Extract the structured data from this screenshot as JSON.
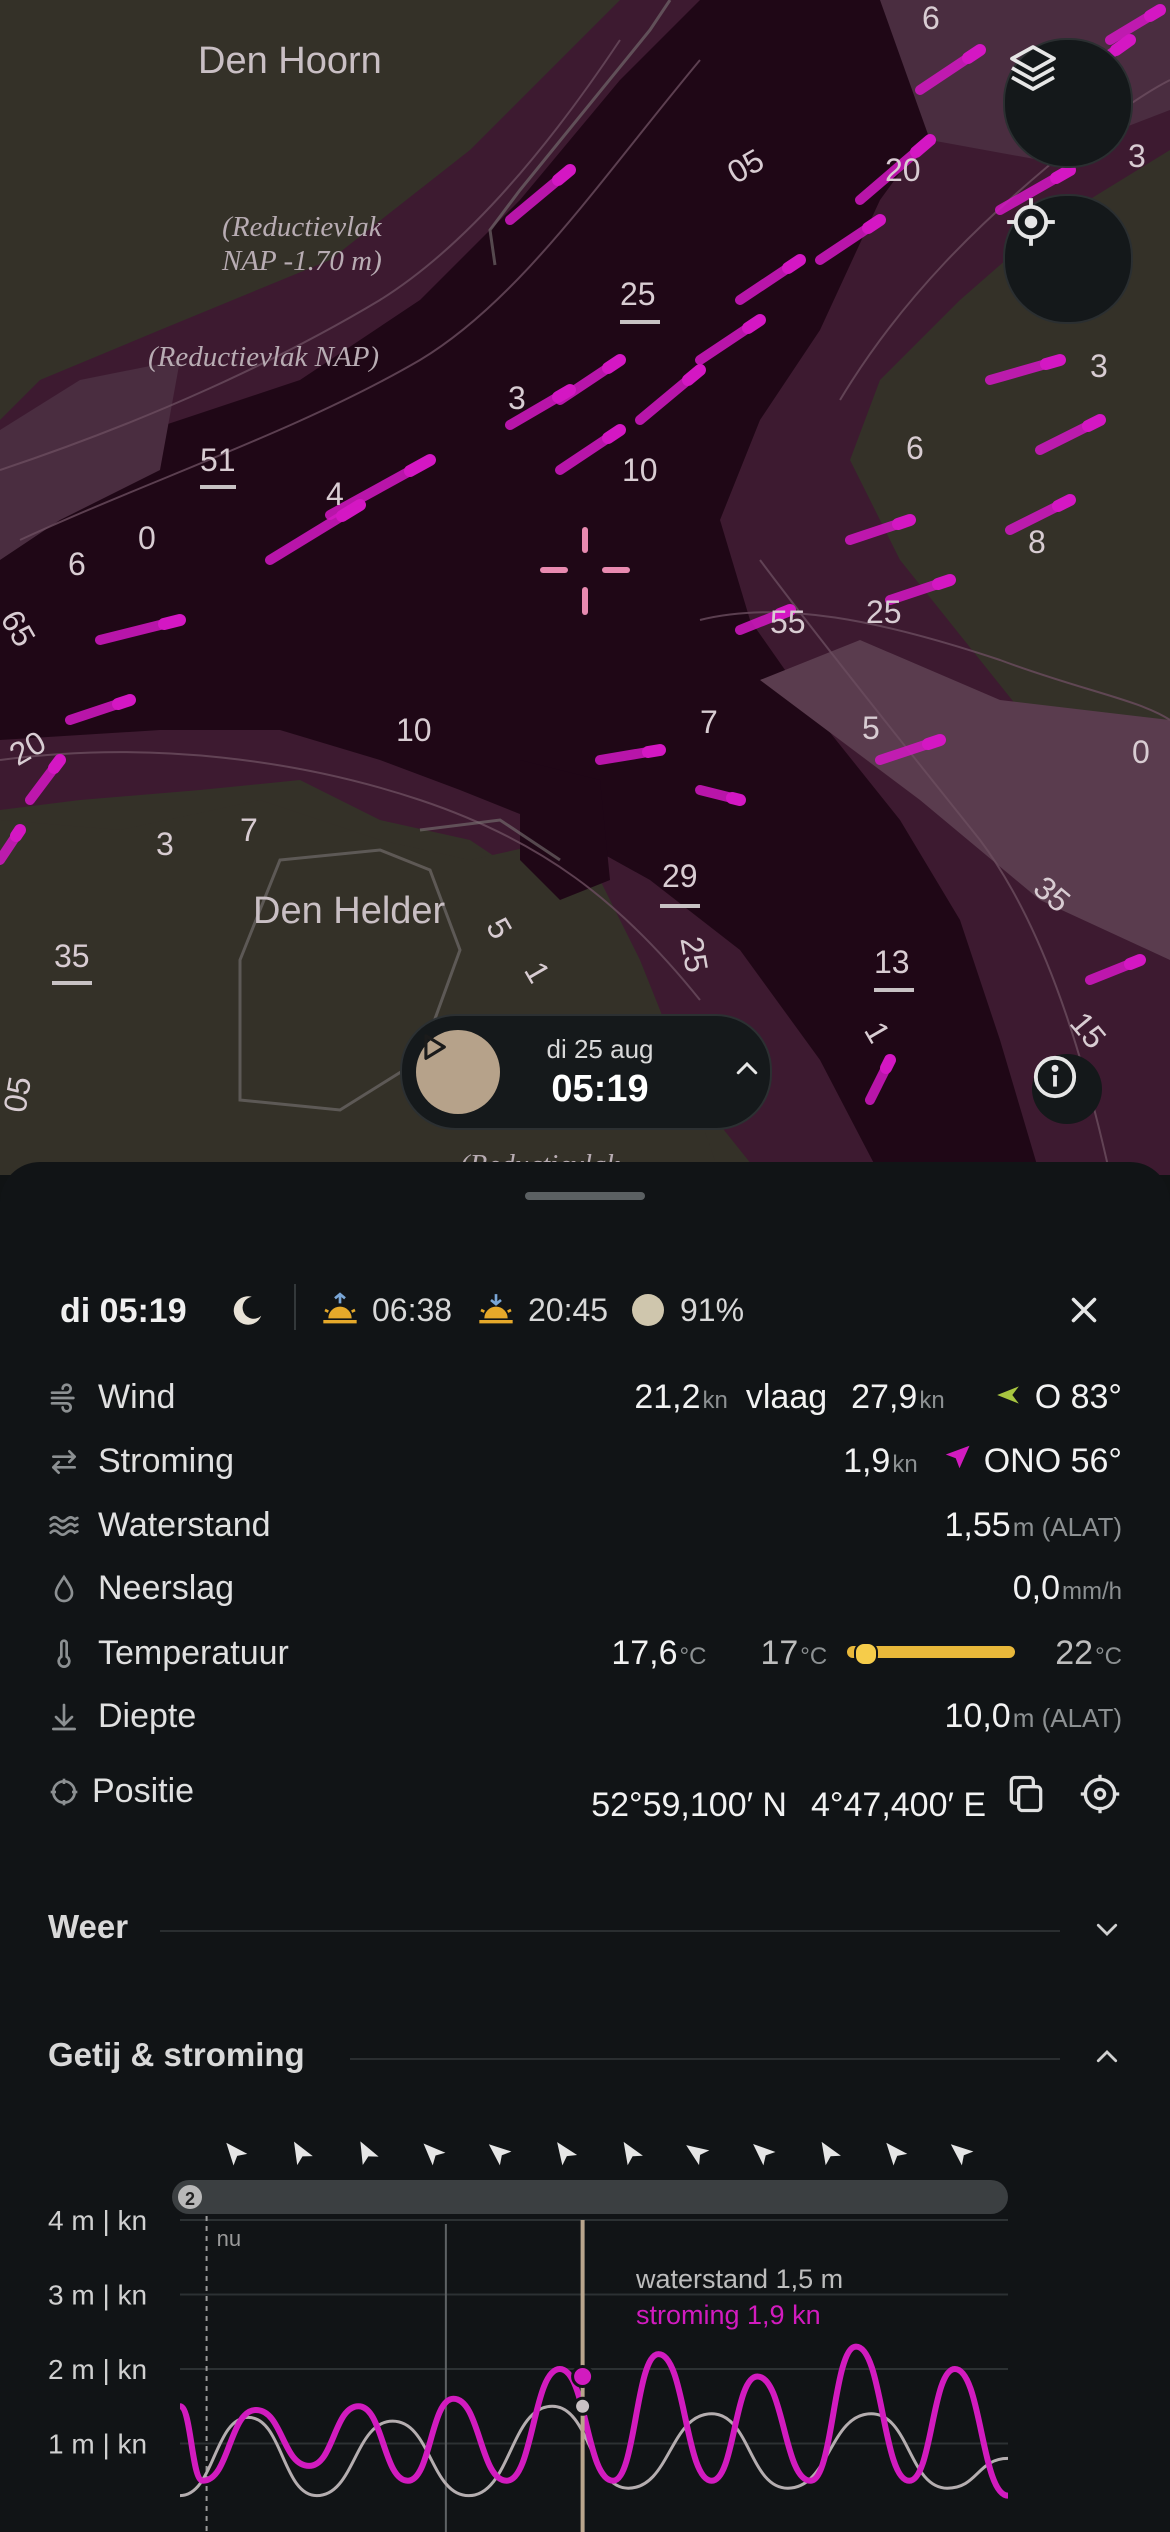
{
  "map": {
    "place_labels": [
      "Den Hoorn",
      "Den Helder"
    ],
    "datum_labels": [
      "(Reductievlak\nNAP -1.70 m)",
      "(Reductievlak NAP)",
      "(Reductievlak"
    ],
    "depths": [
      "05",
      "20",
      "3",
      "25",
      "3",
      "10",
      "6",
      "3",
      "51",
      "4",
      "0",
      "6",
      "8",
      "55",
      "25",
      "65",
      "7",
      "5",
      "20",
      "10",
      "0",
      "3",
      "7",
      "29",
      "35",
      "35",
      "5",
      "1",
      "25",
      "13",
      "1",
      "15",
      "05",
      "6"
    ],
    "colors": {
      "land": "#343128",
      "water_deep": "#1f0716",
      "water_mid": "#3d1a30",
      "shoal": "#5a3c4e",
      "current_arrow": "#d417c3"
    }
  },
  "player": {
    "date": "di 25 aug",
    "time": "05:19"
  },
  "summary": {
    "day_time": "di 05:19",
    "sunrise": "06:38",
    "sunset": "20:45",
    "moon_illumination": "91%"
  },
  "rows": {
    "wind": {
      "label": "Wind",
      "speed": "21,2",
      "speed_unit": "kn",
      "gust_label": "vlaag",
      "gust": "27,9",
      "gust_unit": "kn",
      "direction": "O 83°"
    },
    "current": {
      "label": "Stroming",
      "speed": "1,9",
      "unit": "kn",
      "direction": "ONO 56°"
    },
    "tide": {
      "label": "Waterstand",
      "value": "1,55",
      "unit": "m (ALAT)"
    },
    "rain": {
      "label": "Neerslag",
      "value": "0,0",
      "unit": "mm/h"
    },
    "temperature": {
      "label": "Temperatuur",
      "air": "17,6",
      "air_unit": "°C",
      "water_min": "17",
      "water_min_unit": "°C",
      "water_max": "22",
      "water_max_unit": "°C",
      "level_fraction": 0.1
    },
    "depth": {
      "label": "Diepte",
      "value": "10,0",
      "unit": "m (ALAT)"
    },
    "position": {
      "label": "Positie",
      "lat": "52°59,100′ N",
      "lon": "4°47,400′ E"
    }
  },
  "sections": {
    "weather": "Weer",
    "tide_current": "Getij & stroming"
  },
  "chart_data": {
    "type": "line",
    "y_tick_labels": [
      "4 m | kn",
      "3 m | kn",
      "2 m | kn",
      "1 m | kn"
    ],
    "ylim": [
      0,
      4.5
    ],
    "now_label": "nu",
    "badge": "2",
    "tooltip": {
      "tide": "waterstand 1,5 m",
      "current": "stroming 1,9 kn"
    },
    "current_directions_deg": [
      50,
      60,
      62,
      45,
      40,
      55,
      58,
      35,
      42,
      58,
      50,
      40
    ],
    "series": [
      {
        "color": "#d21bbf",
        "points": [
          [
            0,
            1.5
          ],
          [
            0.3,
            0.5
          ],
          [
            1.0,
            1.45
          ],
          [
            1.7,
            0.7
          ],
          [
            2.35,
            1.5
          ],
          [
            3.0,
            0.5
          ],
          [
            3.6,
            1.6
          ],
          [
            4.3,
            0.5
          ],
          [
            5.0,
            2.0
          ],
          [
            5.7,
            0.5
          ],
          [
            6.3,
            2.2
          ],
          [
            7.0,
            0.5
          ],
          [
            7.6,
            1.9
          ],
          [
            8.3,
            0.5
          ],
          [
            8.9,
            2.3
          ],
          [
            9.6,
            0.5
          ],
          [
            10.2,
            2.0
          ],
          [
            10.9,
            0.3
          ]
        ]
      },
      {
        "color": "#b5aeb0",
        "points": [
          [
            0,
            0.3
          ],
          [
            0.9,
            1.35
          ],
          [
            1.8,
            0.3
          ],
          [
            2.8,
            1.3
          ],
          [
            3.8,
            0.3
          ],
          [
            4.9,
            1.5
          ],
          [
            5.9,
            0.4
          ],
          [
            7.0,
            1.4
          ],
          [
            8.0,
            0.4
          ],
          [
            9.1,
            1.4
          ],
          [
            10.1,
            0.4
          ],
          [
            10.9,
            0.8
          ]
        ]
      }
    ],
    "xlim": [
      0,
      10.9
    ],
    "now_x": 0.35,
    "day_x": 3.5,
    "cursor_x": 5.3,
    "cursor_values": {
      "current": 1.9,
      "tide": 1.5
    }
  }
}
